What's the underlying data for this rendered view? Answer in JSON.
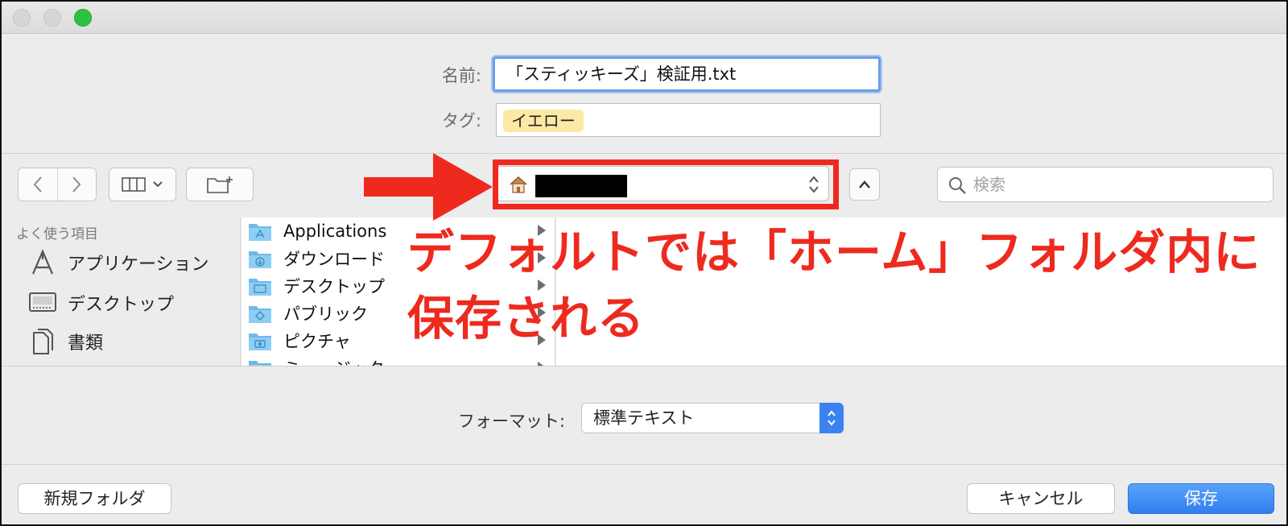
{
  "dialog": {
    "name_label": "名前:",
    "name_value": "「スティッキーズ」検証用.txt",
    "tag_label": "タグ:",
    "tag_value": "イエロー"
  },
  "toolbar": {
    "back_icon": "chevron-left-icon",
    "forward_icon": "chevron-right-icon",
    "view_icon": "column-view-icon",
    "new_folder_icon": "new-folder-icon",
    "path_icon": "home-icon",
    "search_placeholder": "検索"
  },
  "annotation": {
    "text_line1": "デフォルトでは「ホーム」フォルダ内に",
    "text_line2": "保存される",
    "color": "#ee2a1f"
  },
  "sidebar": {
    "heading": "よく使う項目",
    "items": [
      {
        "label": "アプリケーション",
        "icon": "applications-icon"
      },
      {
        "label": "デスクトップ",
        "icon": "desktop-icon"
      },
      {
        "label": "書類",
        "icon": "documents-icon"
      }
    ]
  },
  "column": {
    "items": [
      {
        "label": "Applications",
        "icon": "folder-icon"
      },
      {
        "label": "ダウンロード",
        "icon": "folder-icon"
      },
      {
        "label": "デスクトップ",
        "icon": "folder-icon"
      },
      {
        "label": "パブリック",
        "icon": "folder-icon"
      },
      {
        "label": "ピクチャ",
        "icon": "folder-icon"
      },
      {
        "label": "ミュージック",
        "icon": "folder-icon"
      }
    ]
  },
  "format": {
    "label": "フォーマット:",
    "value": "標準テキスト"
  },
  "buttons": {
    "new_folder": "新規フォルダ",
    "cancel": "キャンセル",
    "save": "保存"
  },
  "colors": {
    "accent": "#3b82f0",
    "tag_yellow": "#fde9a6"
  }
}
